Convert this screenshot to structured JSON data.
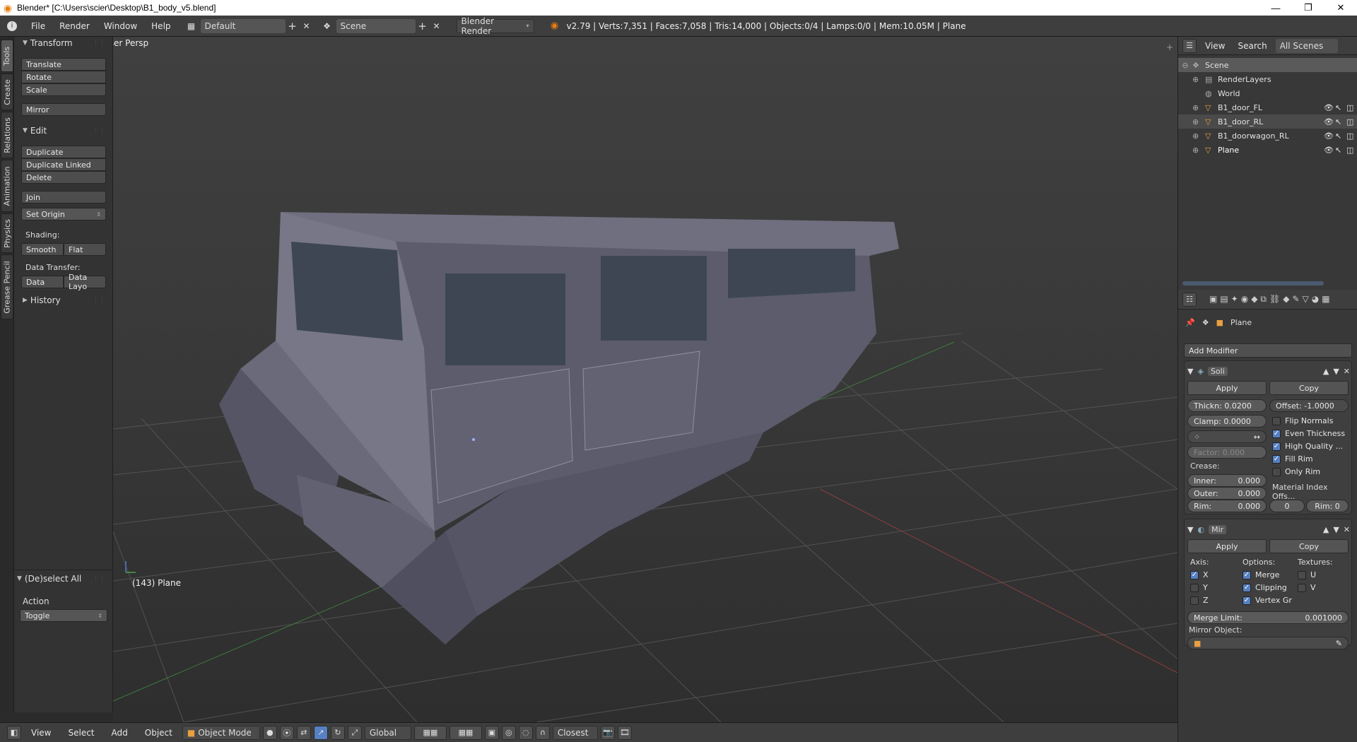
{
  "window": {
    "title": "Blender* [C:\\Users\\scier\\Desktop\\B1_body_v5.blend]",
    "controls": [
      "minimize-icon",
      "maximize-icon",
      "close-icon"
    ]
  },
  "info_header": {
    "menus": [
      "File",
      "Render",
      "Window",
      "Help"
    ],
    "screen_layout": "Default",
    "scene": "Scene",
    "render_engine": "Blender Render",
    "stats": "v2.79 | Verts:7,351 | Faces:7,058 | Tris:14,000 | Objects:0/4 | Lamps:0/0 | Mem:10.05M | Plane"
  },
  "tool_tabs": [
    "Tools",
    "Create",
    "Relations",
    "Animation",
    "Physics",
    "Grease Pencil"
  ],
  "tool_shelf": {
    "transform_title": "Transform",
    "translate": "Translate",
    "rotate": "Rotate",
    "scale": "Scale",
    "mirror": "Mirror",
    "edit_title": "Edit",
    "duplicate": "Duplicate",
    "duplicate_linked": "Duplicate Linked",
    "delete": "Delete",
    "join": "Join",
    "set_origin": "Set Origin",
    "shading_label": "Shading:",
    "smooth": "Smooth",
    "flat": "Flat",
    "data_transfer_label": "Data Transfer:",
    "data": "Data",
    "data_layout": "Data Layo",
    "history_title": "History"
  },
  "operator_panel": {
    "title": "(De)select All",
    "action_label": "Action",
    "action_value": "Toggle"
  },
  "viewport": {
    "view_label": "User Persp",
    "object_label": "(143) Plane"
  },
  "bottom_header": {
    "menus": [
      "View",
      "Select",
      "Add",
      "Object"
    ],
    "mode": "Object Mode",
    "orientation": "Global",
    "snap_target": "Closest"
  },
  "outliner": {
    "view": "View",
    "search": "Search",
    "filter": "All Scenes",
    "items": [
      "Scene",
      "RenderLayers",
      "World",
      "B1_door_FL",
      "B1_door_RL",
      "B1_doorwagon_RL",
      "Plane"
    ]
  },
  "properties": {
    "object_name": "Plane",
    "add_modifier": "Add Modifier",
    "solidify": {
      "name": "Soli",
      "apply": "Apply",
      "copy": "Copy",
      "thickness": "Thickn: 0.0200",
      "offset": "Offset: -1.0000",
      "clamp": "Clamp: 0.0000",
      "flip_normals": "Flip Normals",
      "even_thickness": "Even Thickness",
      "high_quality": "High Quality ...",
      "fill_rim": "Fill Rim",
      "only_rim": "Only Rim",
      "factor": "Factor:   0.000",
      "crease_label": "Crease:",
      "inner_label": "Inner:",
      "inner_value": "0.000",
      "outer_label": "Outer:",
      "outer_value": "0.000",
      "rim_label": "Rim:",
      "rim_value": "0.000",
      "material_index_label": "Material Index Offs...",
      "mat_offset": "0",
      "mat_rim": "Rim: 0"
    },
    "mirror": {
      "name": "Mir",
      "apply": "Apply",
      "copy": "Copy",
      "axis_label": "Axis:",
      "options_label": "Options:",
      "textures_label": "Textures:",
      "x": "X",
      "y": "Y",
      "z": "Z",
      "merge": "Merge",
      "clipping": "Clipping",
      "vertex_groups": "Vertex Gr",
      "u": "U",
      "v": "V",
      "merge_limit_label": "Merge Limit:",
      "merge_limit_value": "0.001000",
      "mirror_object_label": "Mirror Object:"
    }
  },
  "colors": {
    "accent": "#5680c2",
    "blender_orange": "#e87d0d",
    "mesh": "#6b6b7a"
  }
}
